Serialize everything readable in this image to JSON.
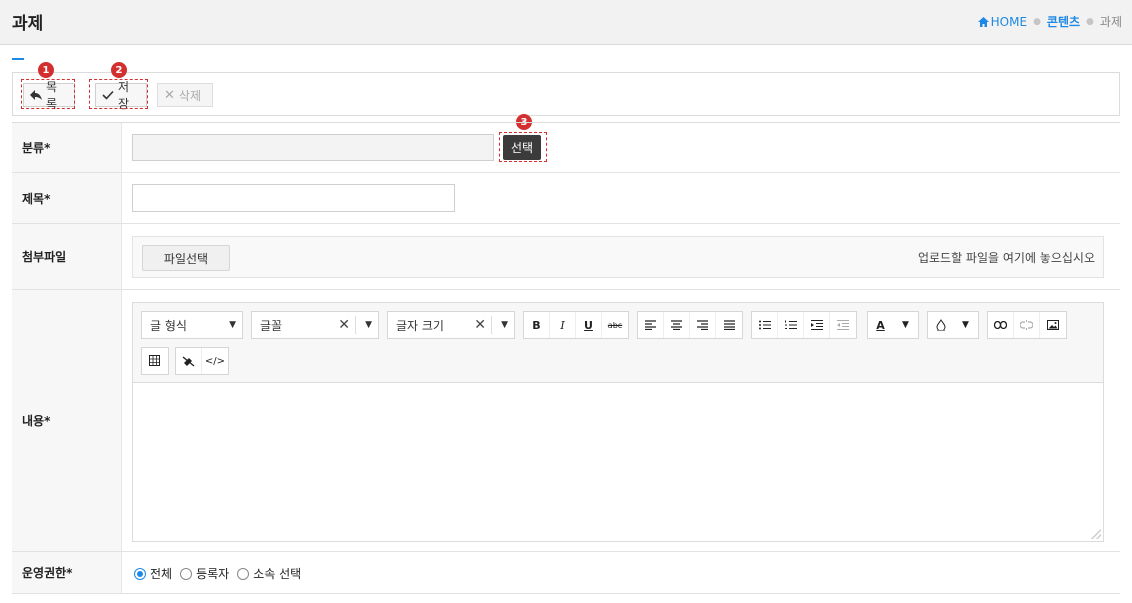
{
  "header": {
    "title": "과제",
    "breadcrumb": {
      "home": "HOME",
      "section": "콘텐츠",
      "current": "과제"
    }
  },
  "toolbar": {
    "list_label": "목록",
    "save_label": "저장",
    "delete_label": "삭제"
  },
  "annotations": [
    "1",
    "2",
    "3"
  ],
  "form": {
    "category": {
      "label": "분류*",
      "value": "",
      "select_button": "선택"
    },
    "title": {
      "label": "제목*",
      "value": ""
    },
    "attachment": {
      "label": "첨부파일",
      "button": "파일선택",
      "hint": "업로드할 파일을 여기에 놓으십시오"
    },
    "content": {
      "label": "내용*",
      "format_select": "글 형식",
      "font_select": "글꼴",
      "size_select": "글자 크기",
      "text_buttons": [
        "B",
        "I",
        "U",
        "abc"
      ]
    },
    "permission": {
      "label": "운영권한*",
      "options": [
        "전체",
        "등록자",
        "소속 선택"
      ],
      "selected": "전체"
    }
  },
  "colors": {
    "accent": "#1e88e5",
    "highlight": "#d32f2f",
    "dark_button": "#3b3b3b"
  }
}
